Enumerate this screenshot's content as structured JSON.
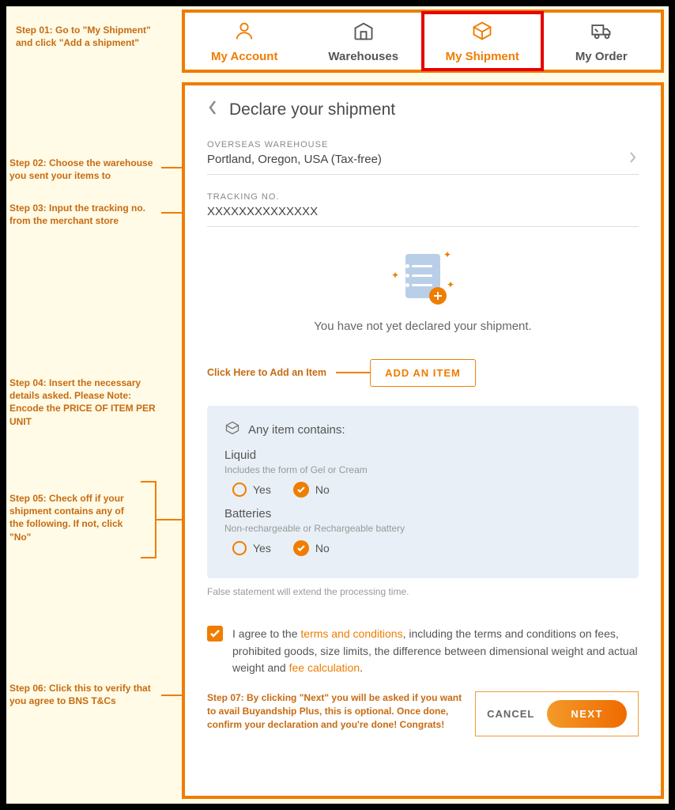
{
  "steps": {
    "s1": "Step 01: Go to \"My Shipment\" and click \"Add a shipment\"",
    "s2": "Step 02: Choose the warehouse you sent your items to",
    "s3": "Step 03: Input the tracking no. from the merchant store",
    "s4": "Step 04: Insert the necessary details asked. Please Note: Encode the PRICE OF ITEM PER UNIT",
    "s5": "Step 05: Check off if your shipment contains any of the following. If not, click \"No\"",
    "s6": "Step 06: Click this to verify that you agree to BNS T&Cs",
    "s7": "Step 07: By clicking \"Next\" you will be asked if you want to avail Buyandship Plus, this is optional. Once done, confirm your declaration and you're done! Congrats!"
  },
  "tabs": {
    "account": "My Account",
    "warehouses": "Warehouses",
    "shipment": "My Shipment",
    "order": "My Order"
  },
  "page": {
    "title": "Declare your shipment",
    "warehouse_label": "OVERSEAS WAREHOUSE",
    "warehouse_value": "Portland, Oregon, USA (Tax-free)",
    "tracking_label": "TRACKING NO.",
    "tracking_value": "XXXXXXXXXXXXXX",
    "empty_text": "You have not yet declared your shipment.",
    "add_annot": "Click Here to Add an Item",
    "add_button": "ADD AN ITEM",
    "card": {
      "title": "Any item contains:",
      "q1_label": "Liquid",
      "q1_desc": "Includes the form of Gel or Cream",
      "q2_label": "Batteries",
      "q2_desc": "Non-rechargeable or Rechargeable battery",
      "yes": "Yes",
      "no": "No",
      "disclaimer": "False statement will extend the processing time."
    },
    "agree": {
      "pre": "I agree to the ",
      "link1": "terms and conditions",
      "mid": ", including the terms and conditions on fees, prohibited goods, size limits, the difference between dimensional weight and actual weight and ",
      "link2": "fee calculation",
      "post": "."
    },
    "cancel": "CANCEL",
    "next": "NEXT"
  }
}
